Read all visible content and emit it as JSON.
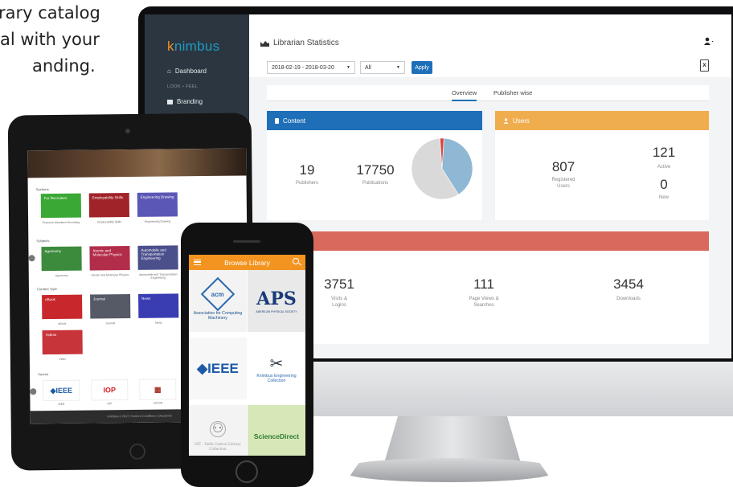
{
  "promo": {
    "line1": "rary catalog",
    "line2": "al with your",
    "line3": "anding."
  },
  "dashboard": {
    "brand_prefix": "k",
    "brand_rest": "nimbus",
    "sidebar": {
      "items": [
        {
          "label": "Dashboard",
          "icon": "home-icon"
        },
        {
          "label": "Branding",
          "icon": "image-icon"
        }
      ],
      "section_header": "LOOK • FEEL"
    },
    "header": {
      "title": "Librarian Statistics",
      "user_icon": "user-icon",
      "export_icon": "excel-export-icon"
    },
    "filters": {
      "date_range": "2018-02-19 - 2018-03-20",
      "scope": "All",
      "apply_label": "Apply"
    },
    "tabs": [
      {
        "label": "Overview",
        "active": true
      },
      {
        "label": "Publisher wise",
        "active": false
      }
    ],
    "content_panel": {
      "title": "Content",
      "color": "#1e6fb8",
      "publishers": {
        "value": "19",
        "label": "Publishers"
      },
      "publications": {
        "value": "17750",
        "label": "Publications"
      },
      "pie": {
        "slices": [
          0.4,
          0.58,
          0.02
        ],
        "colors": [
          "#8fb8d4",
          "#d9d9d9",
          "#e0403a"
        ]
      }
    },
    "users_panel": {
      "title": "Users",
      "color": "#f0ad4e",
      "registered": {
        "value": "807",
        "label_1": "Registered",
        "label_2": "Users"
      },
      "active": {
        "value": "121",
        "label": "Active"
      },
      "new": {
        "value": "0",
        "label": "New"
      }
    },
    "activity_panel": {
      "color": "#d9695c",
      "visits": {
        "value": "3751",
        "label_1": "Visits &",
        "label_2": "Logins"
      },
      "page_views": {
        "value": "111",
        "label_1": "Page Views &",
        "label_2": "Searches"
      },
      "downloads": {
        "value": "3454",
        "label": "Downloads"
      }
    }
  },
  "tablet": {
    "sections": {
      "sections": "Sections",
      "subjects": "Subjects",
      "content_type": "Content Type",
      "source": "Source"
    },
    "section_tiles": [
      {
        "label": "For Recruiters",
        "caption": "Premium Members Recruiting",
        "color": "#3aa835"
      },
      {
        "label": "Employability Skills",
        "caption": "Employability Skills",
        "color": "#a1232a"
      },
      {
        "label": "Engineering Drawing",
        "caption": "Engineering Drawing",
        "color": "#5b57b6"
      }
    ],
    "subject_tiles": [
      {
        "label": "Agronomy",
        "caption": "Agronomy",
        "color": "#3c8a3c"
      },
      {
        "label": "Atomic and Molecular Physics",
        "caption": "Atomic and Molecular Physics",
        "color": "#b22d4a"
      },
      {
        "label": "Automobile and Transportation Engineering",
        "caption": "Automobile and Transportation Engineering",
        "color": "#4b4f8c"
      }
    ],
    "content_tiles": [
      {
        "label": "eBook",
        "caption": "eBook",
        "color": "#c8282c"
      },
      {
        "label": "Journal",
        "caption": "Journal",
        "color": "#555a66"
      },
      {
        "label": "News",
        "caption": "News",
        "color": "#3a3db2"
      },
      {
        "label": "Videos",
        "caption": "Video",
        "color": "#c7343a"
      }
    ],
    "source_tiles": [
      {
        "label": "◆IEEE",
        "caption": "IEEE",
        "color": "#1c5aa8"
      },
      {
        "label": "IOP",
        "caption": "IOP",
        "color": "#d81f26"
      },
      {
        "label": "▦",
        "caption": "JSTOR",
        "color": "#a8332a"
      }
    ],
    "footer": "Knimbus © 2017 | Terms & Conditions | Disclaimer"
  },
  "phone": {
    "title": "Browse Library",
    "tiles": [
      {
        "name": "acm",
        "logo": "acm",
        "caption": "Association for Computing Machinery"
      },
      {
        "name": "aps",
        "logo": "APS",
        "caption": "AMERICAN PHYSICAL SOCIETY"
      },
      {
        "name": "ieee",
        "logo": "◆IEEE",
        "caption": ""
      },
      {
        "name": "knimbus",
        "logo": "✂",
        "caption": "Knimbus Engineering Collection"
      },
      {
        "name": "nit",
        "logo": "⚇",
        "caption": "NIT - Delhi Central Library Collection"
      },
      {
        "name": "sciencedirect",
        "logo": "ScienceDirect",
        "caption": ""
      }
    ]
  }
}
